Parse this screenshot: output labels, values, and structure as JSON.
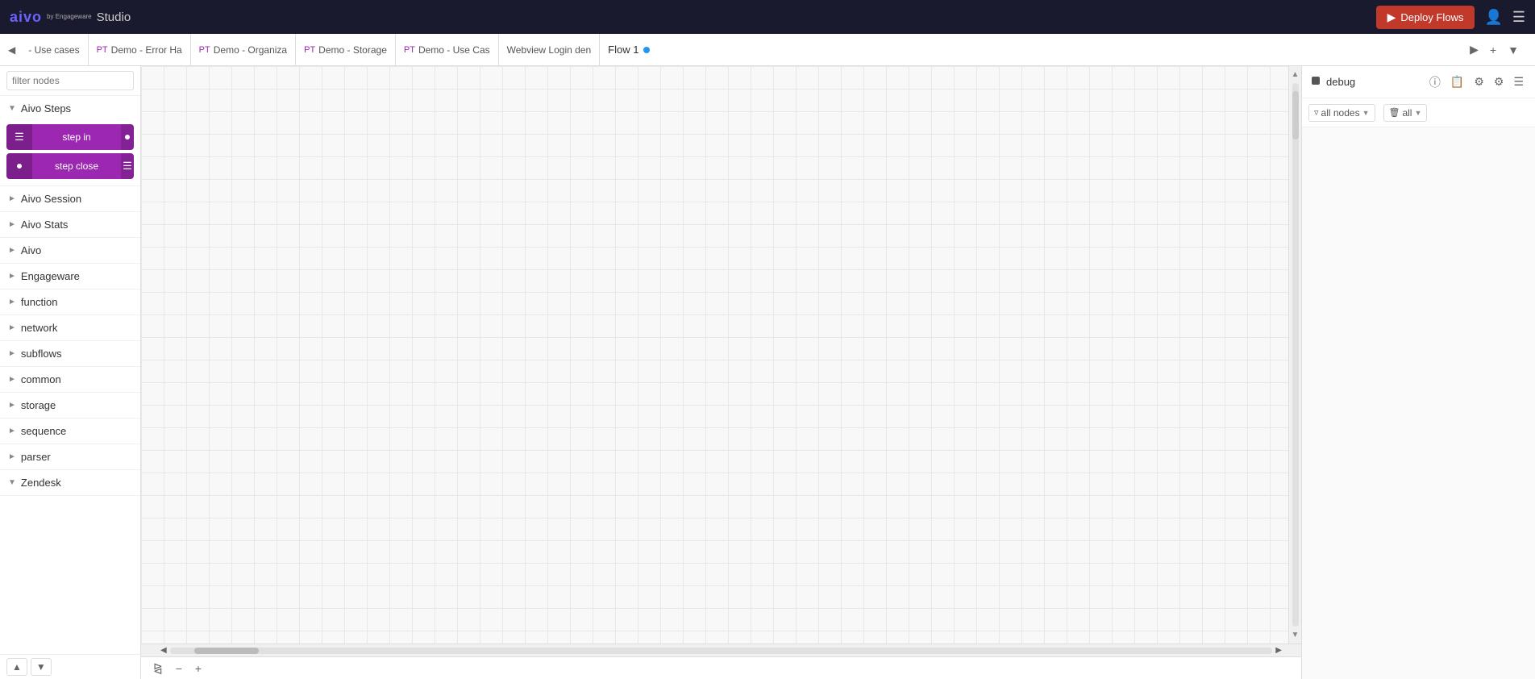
{
  "topbar": {
    "logo_aivo": "aivo",
    "logo_engageware": "by Engageware",
    "logo_studio": "Studio",
    "deploy_btn_label": "Deploy Flows",
    "deploy_icon": "▶",
    "user_icon": "👤",
    "menu_icon": "☰"
  },
  "tabs": {
    "left_arrow": "◀",
    "right_arrow": "▶",
    "items": [
      {
        "id": "use-cases",
        "prefix": "",
        "label": "- Use cases"
      },
      {
        "id": "demo-error",
        "prefix": "PT",
        "label": "Demo - Error Ha"
      },
      {
        "id": "demo-organiza",
        "prefix": "PT",
        "label": "Demo - Organiza"
      },
      {
        "id": "demo-storage",
        "prefix": "PT",
        "label": "Demo - Storage"
      },
      {
        "id": "demo-use-cases",
        "prefix": "PT",
        "label": "Demo - Use Cas"
      },
      {
        "id": "webview-login",
        "prefix": "",
        "label": "Webview Login den"
      }
    ],
    "flow_name": "Flow 1",
    "flow_controls": {
      "run": "▶",
      "add": "+",
      "more": "▾"
    }
  },
  "sidebar": {
    "filter_placeholder": "filter nodes",
    "categories": [
      {
        "id": "aivo-steps",
        "label": "Aivo Steps",
        "expanded": true,
        "items": [
          {
            "id": "step-in",
            "label": "step in",
            "color": "purple"
          },
          {
            "id": "step-close",
            "label": "step close",
            "color": "purple"
          }
        ]
      },
      {
        "id": "aivo-session",
        "label": "Aivo Session",
        "expanded": false,
        "items": []
      },
      {
        "id": "aivo-stats",
        "label": "Aivo Stats",
        "expanded": false,
        "items": []
      },
      {
        "id": "aivo",
        "label": "Aivo",
        "expanded": false,
        "items": []
      },
      {
        "id": "engageware",
        "label": "Engageware",
        "expanded": false,
        "items": []
      },
      {
        "id": "function",
        "label": "function",
        "expanded": false,
        "items": []
      },
      {
        "id": "network",
        "label": "network",
        "expanded": false,
        "items": []
      },
      {
        "id": "subflows",
        "label": "subflows",
        "expanded": false,
        "items": []
      },
      {
        "id": "common",
        "label": "common",
        "expanded": false,
        "items": []
      },
      {
        "id": "storage",
        "label": "storage",
        "expanded": false,
        "items": []
      },
      {
        "id": "sequence",
        "label": "sequence",
        "expanded": false,
        "items": []
      },
      {
        "id": "parser",
        "label": "parser",
        "expanded": false,
        "items": []
      },
      {
        "id": "zendesk",
        "label": "Zendesk",
        "expanded": false,
        "items": []
      }
    ],
    "footer_up": "▲",
    "footer_down": "▼"
  },
  "right_panel": {
    "icon": "⬛",
    "label": "debug",
    "icons": [
      "ℹ",
      "📋",
      "⚙",
      "⚙",
      "☰"
    ],
    "filter": {
      "all_nodes_label": "all nodes",
      "all_label": "all",
      "filter_icon": "⬛"
    }
  },
  "canvas": {
    "zoom_icon": "⊞",
    "zoom_out": "−",
    "zoom_in": "+",
    "fit_icon": "⤢"
  }
}
